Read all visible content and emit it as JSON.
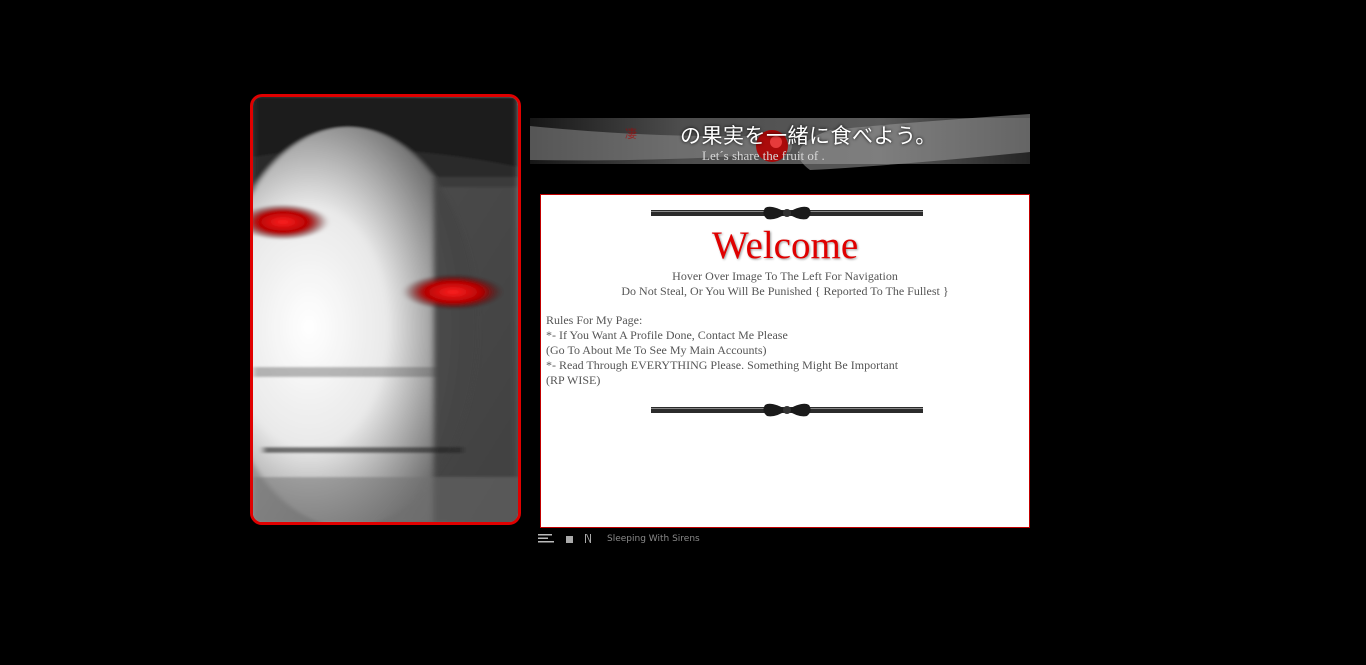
{
  "banner": {
    "japanese_text": "の果実を一緒に食べよう。",
    "english_text": "Let´s share the fruit of        ."
  },
  "panel": {
    "welcome": "Welcome",
    "lines": [
      "Hover Over Image To The Left For Navigation",
      "Do Not Steal, Or You Will Be Punished { Reported To The Fullest }"
    ],
    "rules": [
      "Rules For My Page:",
      "*- If You Want A Profile Done, Contact Me Please",
      "(Go To About Me To See My Main Accounts)",
      "*- Read Through EVERYTHING Please. Something Might Be Important",
      "(RP WISE)"
    ]
  },
  "player": {
    "track": "Sleeping With Sirens",
    "icons": [
      "playlist-icon",
      "stop-icon",
      "next-icon"
    ]
  },
  "colors": {
    "background": "#000000",
    "accent_red": "#e00000",
    "panel_bg": "#ffffff",
    "body_text": "#555555"
  }
}
